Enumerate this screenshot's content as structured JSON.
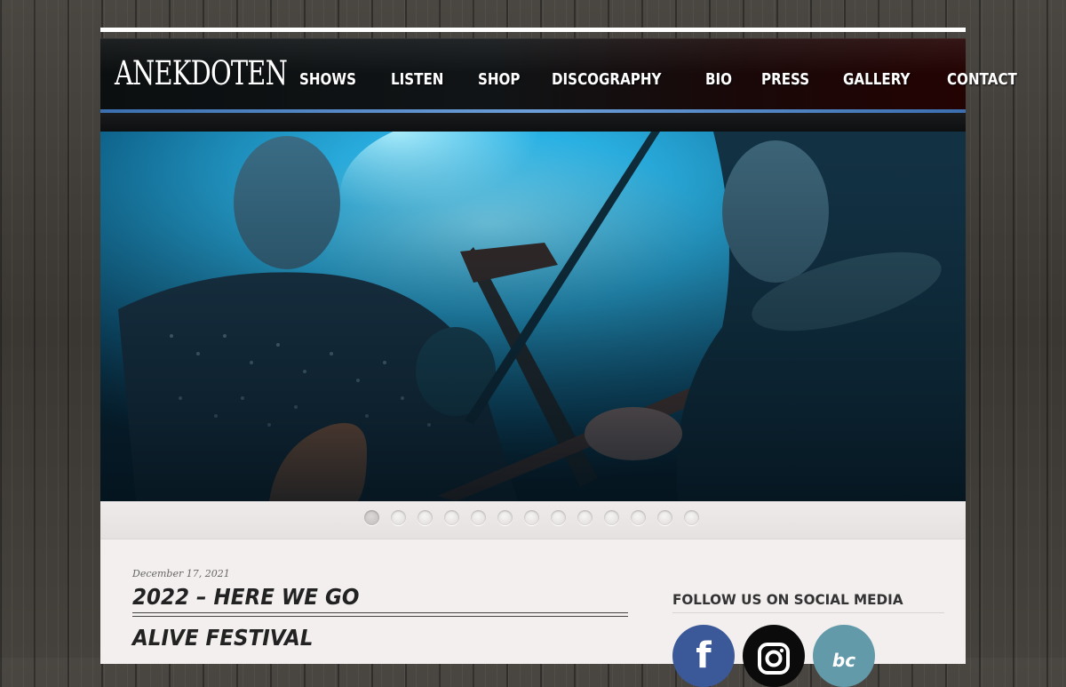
{
  "site": {
    "logo": "ANEKDOTEN"
  },
  "nav": {
    "items": [
      {
        "label": "SHOWS"
      },
      {
        "label": "LISTEN"
      },
      {
        "label": "SHOP"
      },
      {
        "label": "DISCOGRAPHY"
      },
      {
        "label": "BIO"
      },
      {
        "label": "PRESS"
      },
      {
        "label": "GALLERY"
      },
      {
        "label": "CONTACT"
      }
    ]
  },
  "slider": {
    "dot_count": 13,
    "active_index": 0
  },
  "post": {
    "date": "December 17, 2021",
    "title": "2022 – HERE WE GO",
    "subheading": "ALIVE FESTIVAL"
  },
  "sidebar": {
    "follow_title": "FOLLOW US ON SOCIAL MEDIA",
    "social": [
      {
        "name": "facebook-icon",
        "glyph": "f"
      },
      {
        "name": "instagram-icon",
        "glyph": ""
      },
      {
        "name": "bandcamp-icon",
        "glyph": "bc"
      }
    ]
  },
  "colors": {
    "header_dark": "#101416",
    "header_red": "#240303",
    "accent_blue": "#6c9fd9",
    "facebook": "#3b5998",
    "instagram": "#0b0b0b",
    "bandcamp": "#629aa9"
  }
}
